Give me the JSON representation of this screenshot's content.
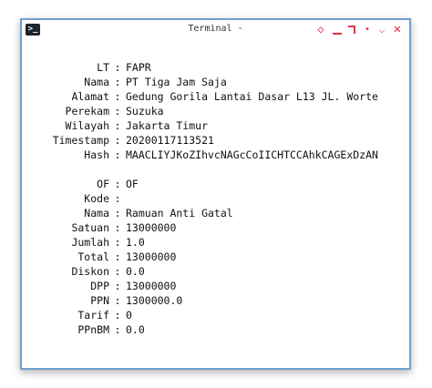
{
  "window": {
    "title": "Terminal -",
    "controls": {
      "diamond": "◇",
      "chevron": "⌵",
      "dot": "•",
      "close": "✕"
    }
  },
  "sep": ":",
  "rows": [
    {
      "label": "LT",
      "value": "FAPR"
    },
    {
      "label": "Nama",
      "value": "PT Tiga Jam Saja"
    },
    {
      "label": "Alamat",
      "value": "Gedung Gorila Lantai Dasar L13 JL. Worte"
    },
    {
      "label": "Perekam",
      "value": "Suzuka"
    },
    {
      "label": "Wilayah",
      "value": "Jakarta Timur"
    },
    {
      "label": "Timestamp",
      "value": "20200117113521"
    },
    {
      "label": "Hash",
      "value": "MAACLIYJKoZIhvcNAGcCoIICHTCCAhkCAGExDzAN"
    },
    {
      "label": "OF",
      "value": "OF"
    },
    {
      "label": "Kode",
      "value": ""
    },
    {
      "label": "Nama",
      "value": "Ramuan Anti Gatal"
    },
    {
      "label": "Satuan",
      "value": "13000000"
    },
    {
      "label": "Jumlah",
      "value": "1.0"
    },
    {
      "label": "Total",
      "value": "13000000"
    },
    {
      "label": "Diskon",
      "value": "0.0"
    },
    {
      "label": "DPP",
      "value": "13000000"
    },
    {
      "label": "PPN",
      "value": "1300000.0"
    },
    {
      "label": "Tarif",
      "value": "0"
    },
    {
      "label": "PPnBM",
      "value": "0.0"
    }
  ]
}
